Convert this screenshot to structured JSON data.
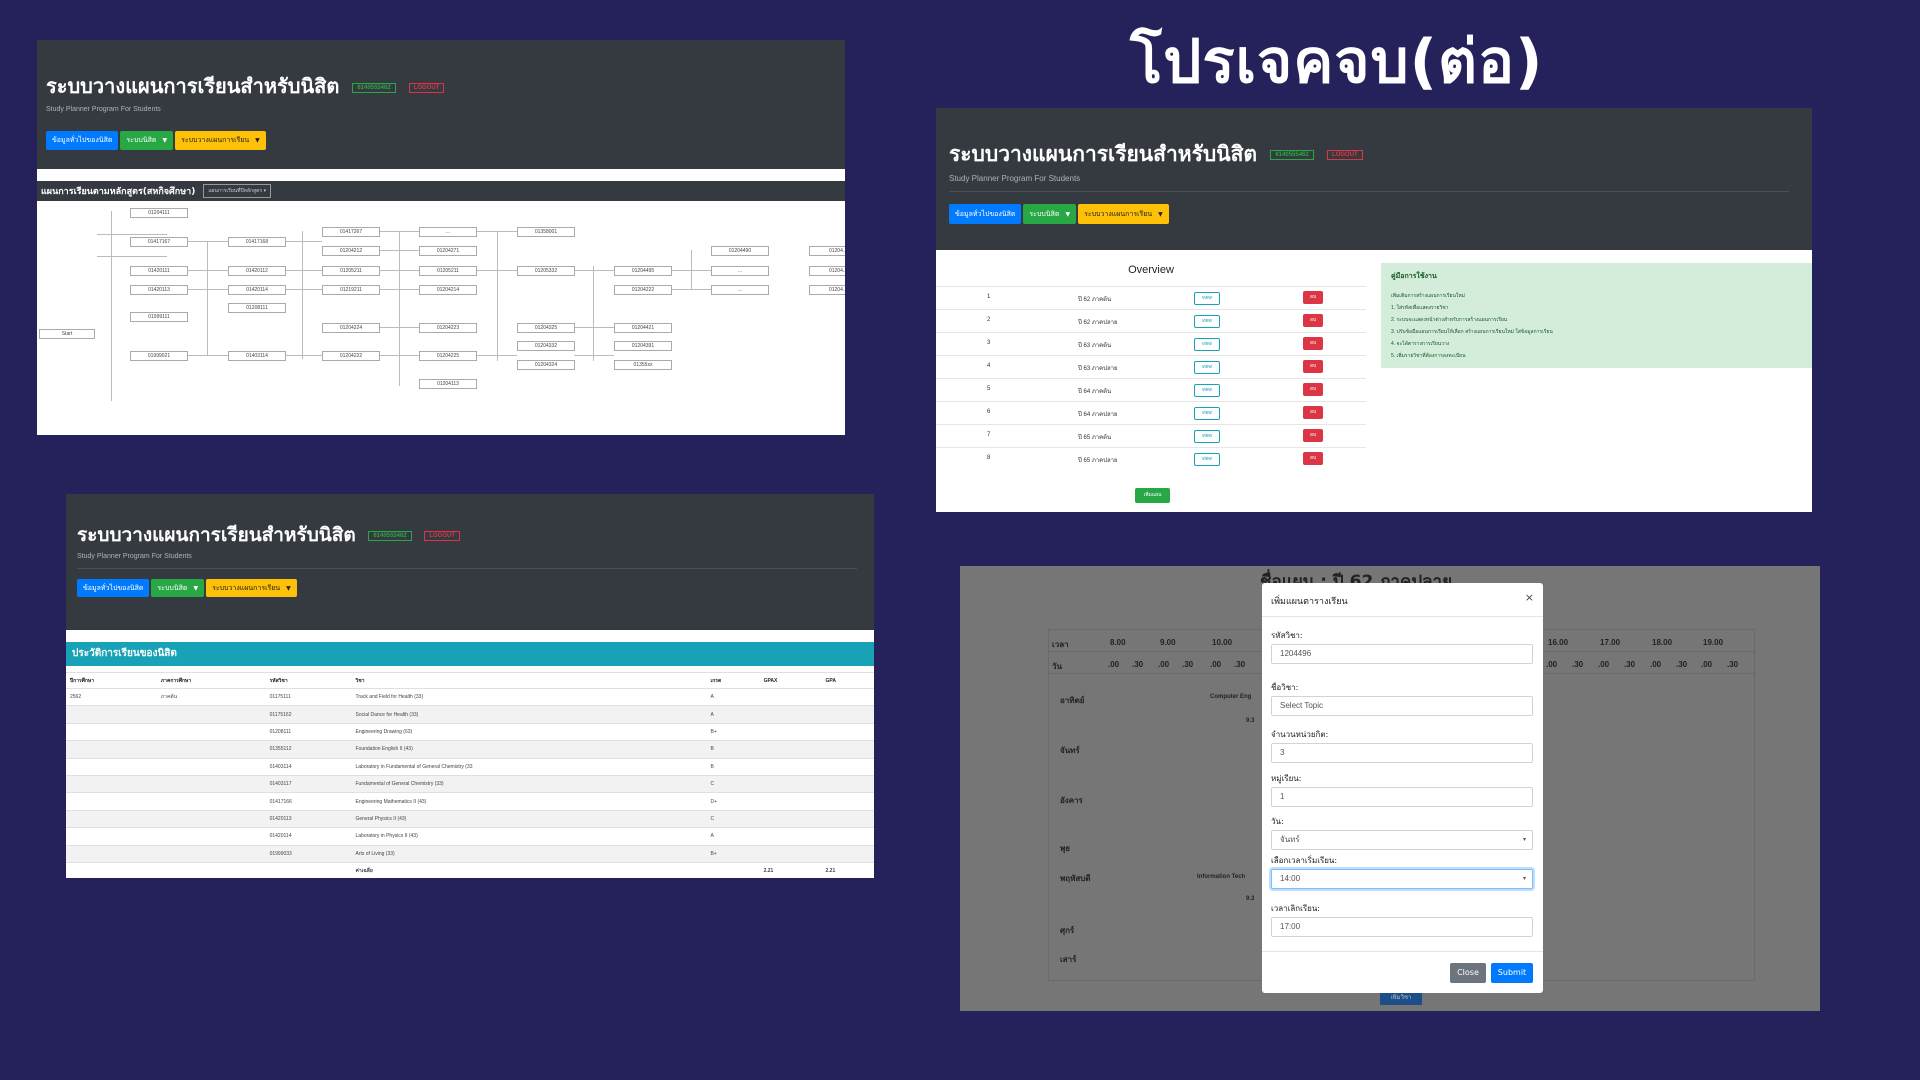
{
  "slide_title": "โปรเจคจบ(ต่อ)",
  "app": {
    "title": "ระบบวางแผนการเรียนสำหรับนิสิต",
    "subtitle": "Study Planner Program For Students",
    "badge_id": "6140555462",
    "badge_logout": "LOGOUT",
    "buttons": {
      "info": "ข้อมูลทั่วไปของนิสิต",
      "system": "ระบบนิสิต",
      "planner": "ระบบวางแผนการเรียน"
    }
  },
  "curriculum": {
    "heading": "แผนการเรียนตามหลักสูตร(สหกิจศึกษา)",
    "select": "แผนการเรียนที่ปีหลักสูตร",
    "start": "Start",
    "nodes": [
      "01204111",
      "01417167",
      "01420111",
      "01420113",
      "01999111",
      "01999021",
      "01417168",
      "01420112",
      "01420114",
      "01208111",
      "01403114",
      "01417267",
      "01204212",
      "01205211",
      "01219211",
      "01204224",
      "01204222",
      "...",
      "01204271",
      "01205211",
      "01204214",
      "01204223",
      "01204225",
      "01204113",
      "01358001",
      "01205332",
      "01204325",
      "01204332",
      "01204324",
      "01204495",
      "01204222",
      "01204421",
      "01204391",
      "01355xx",
      "01204490",
      "...",
      "...",
      "01204...",
      "01204...",
      "01204..."
    ]
  },
  "overview": {
    "title": "Overview",
    "rows": [
      {
        "n": "1",
        "label": "ปี 62 ภาคต้น"
      },
      {
        "n": "2",
        "label": "ปี 62 ภาคปลาย"
      },
      {
        "n": "3",
        "label": "ปี 63 ภาคต้น"
      },
      {
        "n": "4",
        "label": "ปี 63 ภาคปลาย"
      },
      {
        "n": "5",
        "label": "ปี 64 ภาคต้น"
      },
      {
        "n": "6",
        "label": "ปี 64 ภาคปลาย"
      },
      {
        "n": "7",
        "label": "ปี 65 ภาคต้น"
      },
      {
        "n": "8",
        "label": "ปี 65 ภาคปลาย"
      }
    ],
    "view_label": "view",
    "delete_label": "ลบ",
    "add_label": "เพิ่มแผน",
    "manual_title": "คู่มือการใช้งาน",
    "manual_lines": [
      "เพิ่มเติมการสร้างแผนการเรียนใหม่",
      "1. ใส่รหัสเพื่อแสดงรายวิชา",
      "2. ระบบจะแสดงหน้าต่างสำหรับการสร้างแผนการเรียน",
      "3. ปรับข้อมือแผนการเรียนให้เลือก สร้างแผนการเรียนใหม่ ใส่ข้อมูลการเรียน",
      "4. จะได้ตารางการเรียนวาง",
      "5. เพิ่มรายวิชาที่ต้องการลงทะเบียน"
    ]
  },
  "history": {
    "title": "ประวัติการเรียนของนิสิต",
    "headers": [
      "ปีการศึกษา",
      "ภาคการศึกษา",
      "รหัสวิชา",
      "วิชา",
      "เกรด",
      "GPAX",
      "GPA"
    ],
    "rows": [
      [
        "2562",
        "ภาคต้น",
        "01175111",
        "Track and Field for Health (33)",
        "A",
        "",
        ""
      ],
      [
        "",
        "",
        "01175162",
        "Social Dance for Health (33)",
        "A",
        "",
        ""
      ],
      [
        "",
        "",
        "01208111",
        "Engineering Drawing (63)",
        "B+",
        "",
        ""
      ],
      [
        "",
        "",
        "01355112",
        "Foundation English II (43)",
        "B",
        "",
        ""
      ],
      [
        "",
        "",
        "01403114",
        "Laboratory in Fundamental of General Chemistry (33",
        "B",
        "",
        ""
      ],
      [
        "",
        "",
        "01403117",
        "Fundamental of General Chemistry (33)",
        "C",
        "",
        ""
      ],
      [
        "",
        "",
        "01417166",
        "Engineering Mathematics II (43)",
        "D+",
        "",
        ""
      ],
      [
        "",
        "",
        "01420113",
        "General Physics II (43)",
        "C",
        "",
        ""
      ],
      [
        "",
        "",
        "01420114",
        "Laboratory in Physics II (43)",
        "A",
        "",
        ""
      ],
      [
        "",
        "",
        "01999033",
        "Arts of Living (33)",
        "B+",
        "",
        ""
      ],
      [
        "",
        "",
        "",
        "ค่าเฉลี่ย",
        "",
        "2.21",
        "2.21"
      ]
    ]
  },
  "schedule": {
    "plan_title": "ชื่อแผน : ปี 62 ภาคปลาย",
    "row_time": "เวลา",
    "row_day": "วัน",
    "times": [
      "8.00",
      "9.00",
      "10.00"
    ],
    "times_right": [
      "16.00",
      "17.00",
      "18.00",
      "19.00"
    ],
    "half": [
      ".00",
      ".30"
    ],
    "days": [
      "อาทิตย์",
      "จันทร์",
      "อังคาร",
      "พุธ",
      "พฤหัสบดี",
      "ศุกร์",
      "เสาร์"
    ],
    "course_a": "Computer Eng",
    "course_a_time": "9.3",
    "course_b": "Information Tech",
    "course_b_time": "9.3",
    "add_course": "เพิ่มวิชา"
  },
  "modal": {
    "title": "เพิ่มแผนตารางเรียน",
    "close_x": "×",
    "fields": [
      {
        "label": "รหัสวิชา:",
        "value": "1204496"
      },
      {
        "label": "ชื่อวิชา:",
        "value": "Select Topic"
      },
      {
        "label": "จำนวนหน่วยกิต:",
        "value": "3"
      },
      {
        "label": "หมู่เรียน:",
        "value": "1"
      },
      {
        "label": "วัน:",
        "value": "จันทร์"
      },
      {
        "label": "เลือกเวลาเริ่มเรียน:",
        "value": "14:00"
      },
      {
        "label": "เวลาเลิกเรียน:",
        "value": "17:00"
      }
    ],
    "close_btn": "Close",
    "submit_btn": "Submit"
  }
}
